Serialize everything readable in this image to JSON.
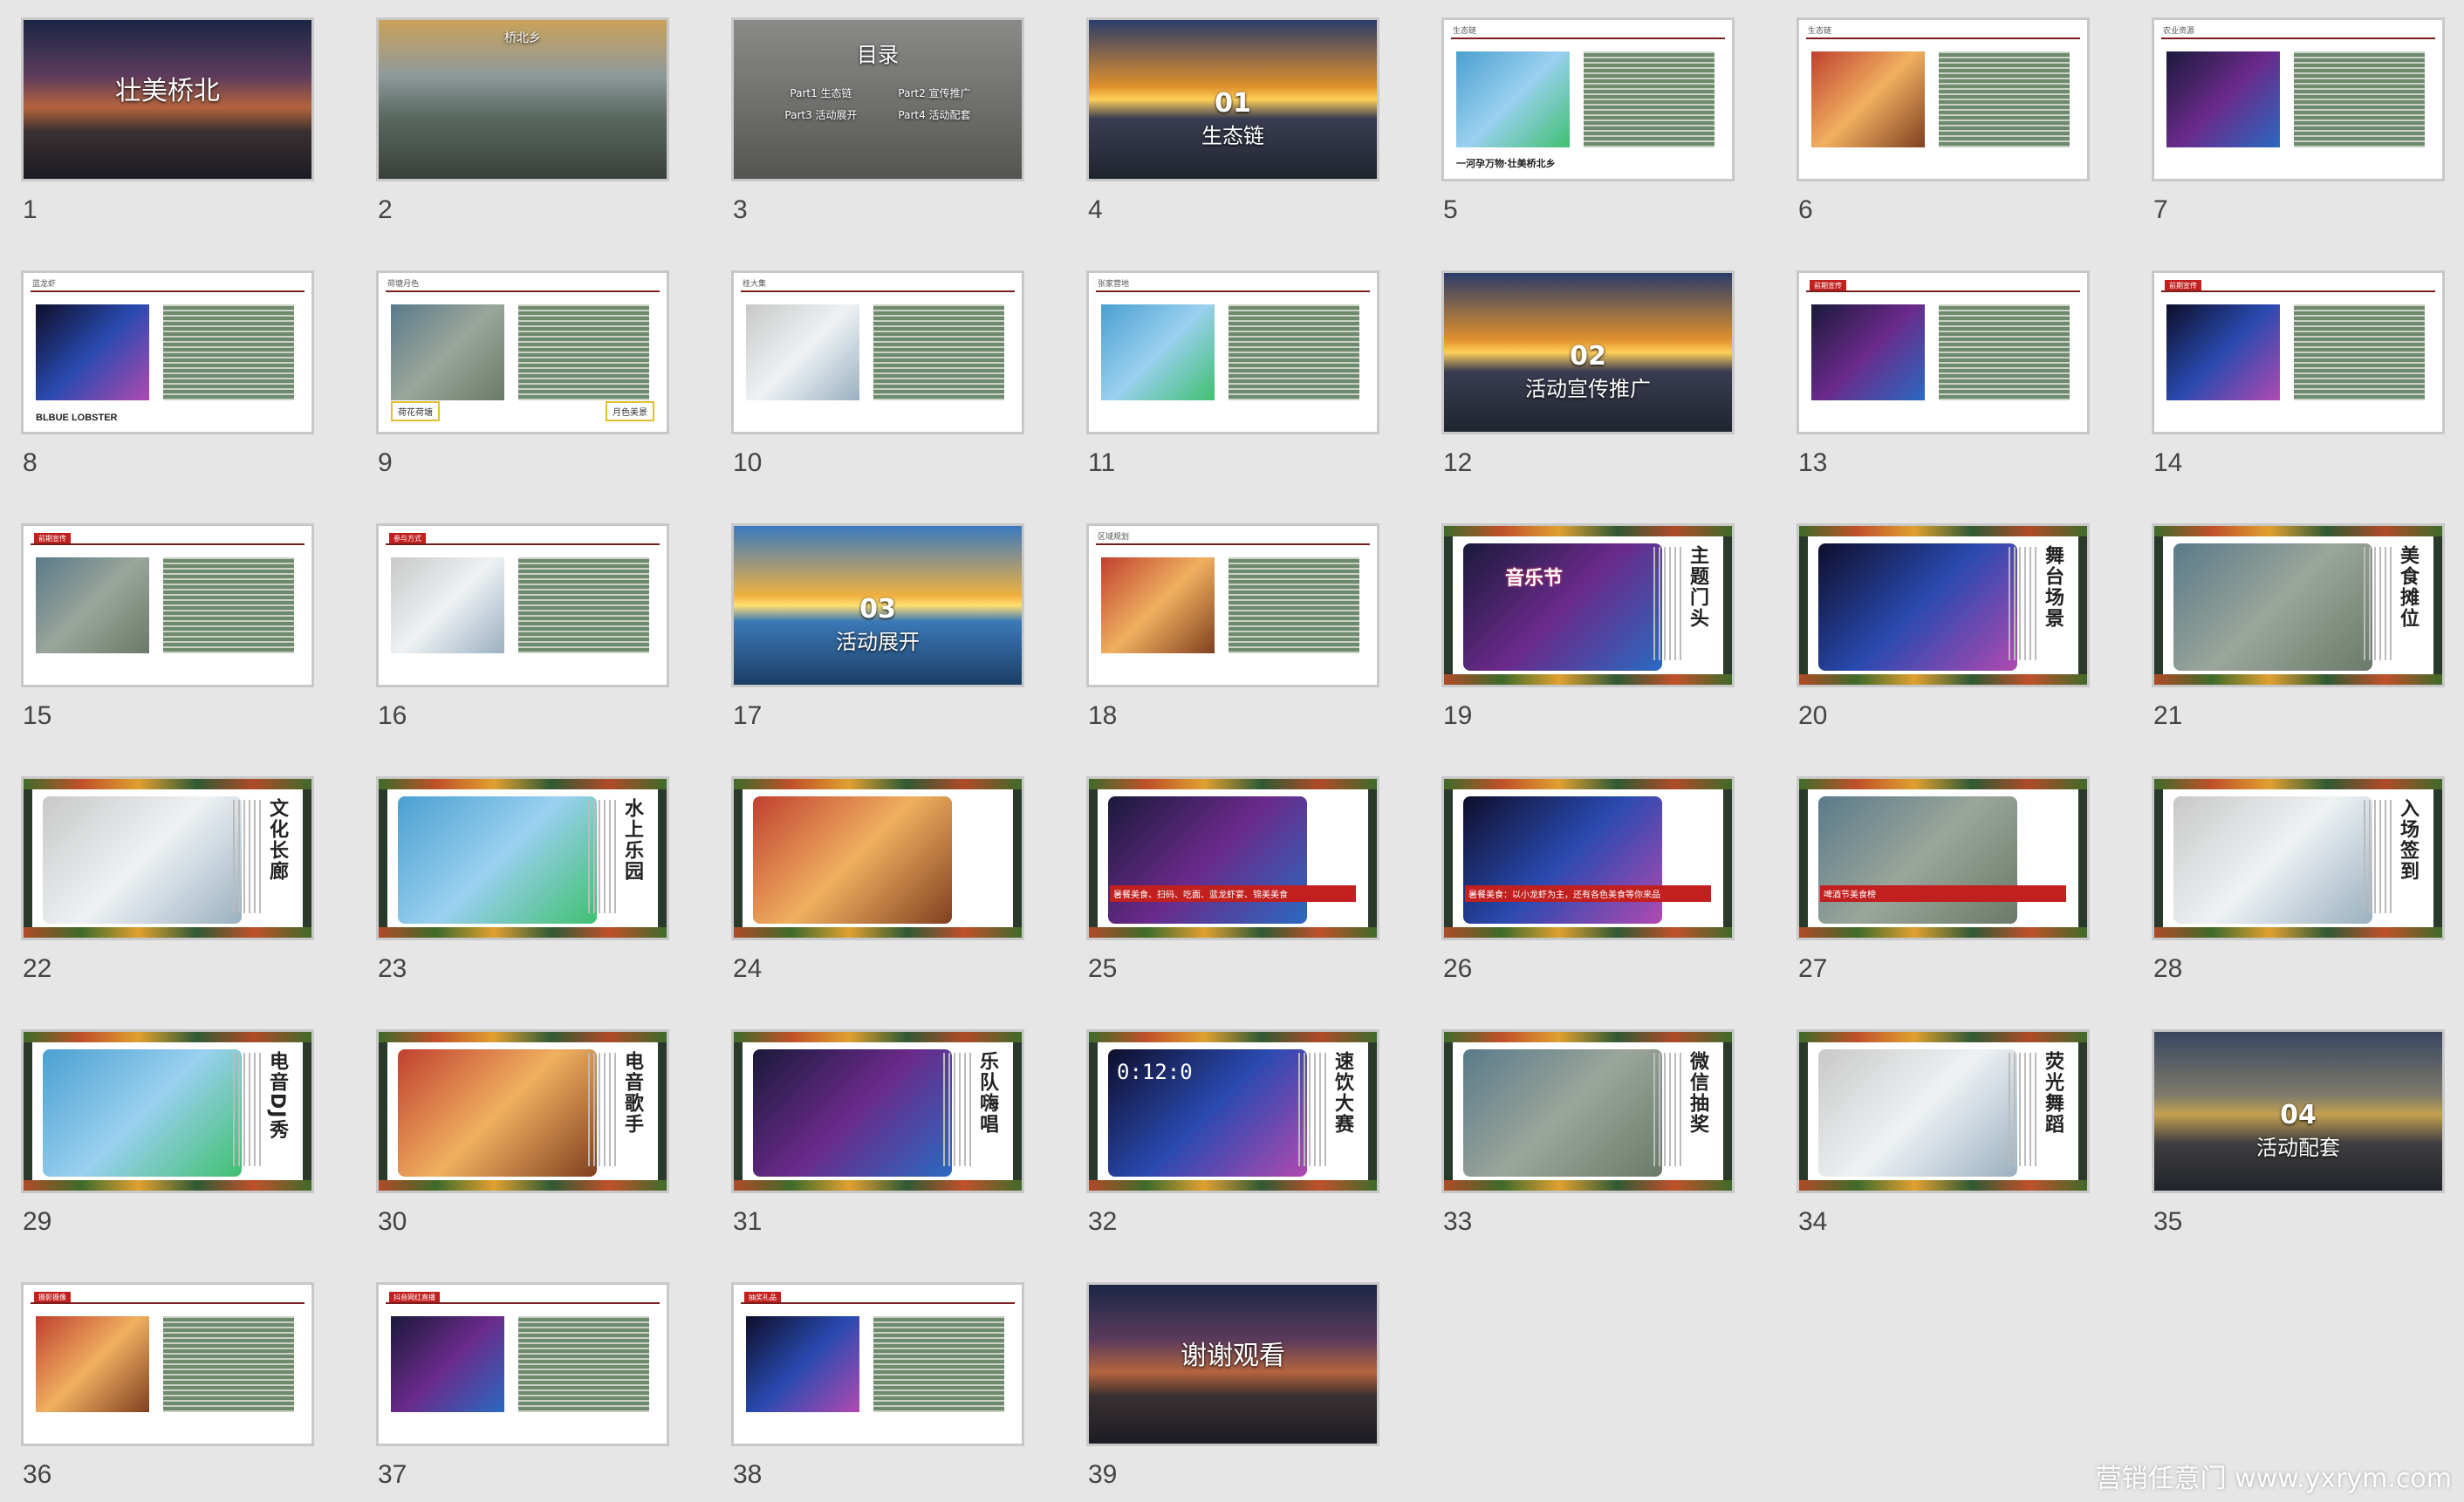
{
  "window": {
    "view": "slide-sorter",
    "total_slides": 39
  },
  "watermark": "营销任意门 www.yxrym.com",
  "slides": [
    {
      "number": "1",
      "theme": "dusk",
      "title": "壮美桥北",
      "subtitle": ""
    },
    {
      "number": "2",
      "theme": "bridge",
      "title": "桥北乡",
      "subtitle": ""
    },
    {
      "number": "3",
      "theme": "gray",
      "title": "目录",
      "items": [
        "Part1 生态链",
        "Part2 宣传推广",
        "Part3 活动展开",
        "Part4 活动配套"
      ]
    },
    {
      "number": "4",
      "theme": "sunset",
      "chapter": "01",
      "title": "生态链"
    },
    {
      "number": "5",
      "theme": "white",
      "header": "生态链",
      "title": "一河孕万物·壮美桥北乡"
    },
    {
      "number": "6",
      "theme": "white",
      "header": "生态链",
      "title": ""
    },
    {
      "number": "7",
      "theme": "white",
      "header": "农业资源",
      "title": ""
    },
    {
      "number": "8",
      "theme": "white",
      "header": "蓝龙虾",
      "title": "BLBUE LOBSTER"
    },
    {
      "number": "9",
      "theme": "white",
      "header": "荷塘月色",
      "labels": [
        "荷花荷塘",
        "月色美景"
      ]
    },
    {
      "number": "10",
      "theme": "white",
      "header": "桂大集",
      "title": ""
    },
    {
      "number": "11",
      "theme": "white",
      "header": "张家营地",
      "title": ""
    },
    {
      "number": "12",
      "theme": "sunset",
      "chapter": "02",
      "title": "活动宣传推广"
    },
    {
      "number": "13",
      "theme": "white",
      "header": "",
      "tag": "前期宣传",
      "title": ""
    },
    {
      "number": "14",
      "theme": "white",
      "header": "",
      "tag": "前期宣传",
      "title": ""
    },
    {
      "number": "15",
      "theme": "white",
      "header": "",
      "tag": "前期宣传",
      "title": ""
    },
    {
      "number": "16",
      "theme": "white",
      "header": "",
      "tag": "参与方式",
      "title": ""
    },
    {
      "number": "17",
      "theme": "lake",
      "chapter": "03",
      "title": "活动展开"
    },
    {
      "number": "18",
      "theme": "white",
      "header": "区域规划",
      "title": ""
    },
    {
      "number": "19",
      "theme": "frame",
      "title": "主题门头",
      "sign": "音乐节"
    },
    {
      "number": "20",
      "theme": "frame",
      "title": "舞台场景"
    },
    {
      "number": "21",
      "theme": "frame",
      "title": "美食摊位"
    },
    {
      "number": "22",
      "theme": "frame",
      "title": "文化长廊"
    },
    {
      "number": "23",
      "theme": "frame",
      "title": "水上乐园"
    },
    {
      "number": "24",
      "theme": "frame",
      "title": ""
    },
    {
      "number": "25",
      "theme": "frame",
      "title": "",
      "caption": "暑餐美食、扫码、吃面、蓝龙虾宴、锦美美食"
    },
    {
      "number": "26",
      "theme": "frame",
      "title": "",
      "caption": "暑餐美食：以小龙虾为主，还有各色美食等你来品"
    },
    {
      "number": "27",
      "theme": "frame",
      "title": "",
      "caption": "啤酒节美食榜"
    },
    {
      "number": "28",
      "theme": "frame",
      "title": "入场签到"
    },
    {
      "number": "29",
      "theme": "frame",
      "title": "电音DJ秀"
    },
    {
      "number": "30",
      "theme": "frame",
      "title": "电音歌手"
    },
    {
      "number": "31",
      "theme": "frame",
      "title": "乐队嗨唱"
    },
    {
      "number": "32",
      "theme": "frame",
      "title": "速饮大赛",
      "timer": "0:12:0"
    },
    {
      "number": "33",
      "theme": "frame",
      "title": "微信抽奖"
    },
    {
      "number": "34",
      "theme": "frame",
      "title": "荧光舞蹈"
    },
    {
      "number": "35",
      "theme": "gold",
      "chapter": "04",
      "title": "活动配套"
    },
    {
      "number": "36",
      "theme": "white",
      "header": "",
      "tag": "摄影摄像",
      "title": ""
    },
    {
      "number": "37",
      "theme": "white",
      "header": "",
      "tag": "抖音网红直播",
      "title": ""
    },
    {
      "number": "38",
      "theme": "white",
      "header": "",
      "tag": "抽奖礼品",
      "title": ""
    },
    {
      "number": "39",
      "theme": "dusk",
      "title": "谢谢观看"
    }
  ],
  "colors": {
    "background": "#e6e6e6",
    "accent_red": "#c21f1f",
    "panel_green": "#6e8a6c"
  }
}
